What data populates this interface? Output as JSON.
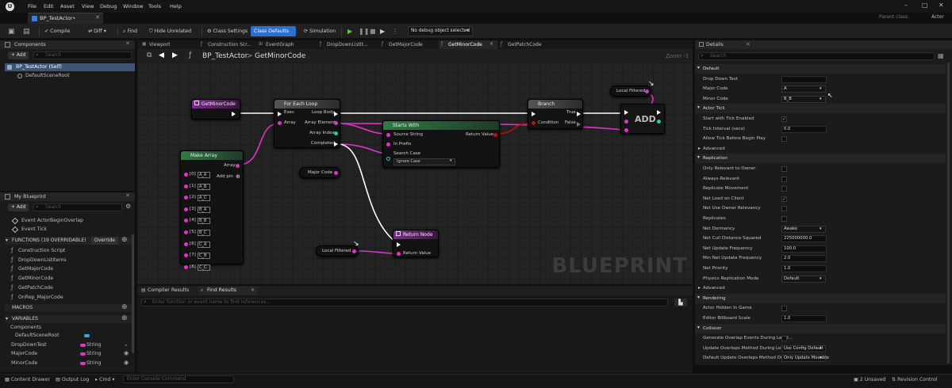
{
  "titlebar": {
    "menus": [
      "File",
      "Edit",
      "Asset",
      "View",
      "Debug",
      "Window",
      "Tools",
      "Help"
    ],
    "parent_label": "Parent class:",
    "parent_value": "Actor"
  },
  "tab": {
    "label": "BP_TestActor•"
  },
  "toolbar": {
    "compile": "Compile",
    "diff": "Diff",
    "find": "Find",
    "hide_unrelated": "Hide Unrelated",
    "class_settings": "Class Settings",
    "class_defaults": "Class Defaults",
    "simulation": "Simulation",
    "debug_object": "No debug object selected"
  },
  "components": {
    "title": "Components",
    "add": "+ Add",
    "search_placeholder": "Search",
    "root": "BP_TestActor (Self)",
    "child": "DefaultSceneRoot"
  },
  "graph_tabs": [
    "Viewport",
    "Construction Scr...",
    "EventGraph",
    "DropDownListIt...",
    "GetMajorCode",
    "GetMinorCode",
    "GetPatchCode"
  ],
  "breadcrumb": {
    "blueprint": "BP_TestActor",
    "sep": ">",
    "function": "GetMinorCode",
    "zoom": "Zoom -1"
  },
  "nodes": {
    "entry": "GetMinorCode",
    "foreach": {
      "title": "For Each Loop",
      "exec": "Exec",
      "array": "Array",
      "loop_body": "Loop Body",
      "array_element": "Array Element",
      "array_index": "Array Index",
      "completed": "Completed"
    },
    "branch": {
      "title": "Branch",
      "condition": "Condition",
      "true": "True",
      "false": "False"
    },
    "add": {
      "title": "ADD",
      "target": "Local Filtered"
    },
    "starts": {
      "title": "Starts With",
      "source": "Source String",
      "prefix": "In Prefix",
      "search_case": "Search Case",
      "case_value": "Ignore Case",
      "return": "Return Value"
    },
    "make_array": {
      "title": "Make Array",
      "array": "Array",
      "add_pin": "Add pin",
      "items": [
        {
          "idx": "[0]",
          "val": "A_A"
        },
        {
          "idx": "[1]",
          "val": "A_B"
        },
        {
          "idx": "[2]",
          "val": "A_C"
        },
        {
          "idx": "[3]",
          "val": "B_A"
        },
        {
          "idx": "[4]",
          "val": "B_B"
        },
        {
          "idx": "[5]",
          "val": "B_C"
        },
        {
          "idx": "[6]",
          "val": "C_A"
        },
        {
          "idx": "[7]",
          "val": "C_B"
        },
        {
          "idx": "[8]",
          "val": "C_C"
        }
      ]
    },
    "major_code": "Major Code",
    "return": {
      "title": "Return Node",
      "value": "Return Value"
    },
    "local_filtered": "Local Filtered"
  },
  "watermark": "BLUEPRINT",
  "my_blueprint": {
    "title": "My Blueprint",
    "add": "+ Add",
    "search_placeholder": "Search",
    "events": [
      "Event ActorBeginOverlap",
      "Event Tick"
    ],
    "functions_header": "FUNCTIONS (19 OVERRIDABLE)",
    "override": "Override",
    "functions": [
      "Construction Script",
      "DropDownListItems",
      "GetMajorCode",
      "GetMinorCode",
      "GetPatchCode",
      "OnRep_MajorCode"
    ],
    "macros": "MACROS",
    "variables": "VARIABLES",
    "components_cat": "Components",
    "variables_list": [
      {
        "name": "DefaultSceneRoot",
        "type": ""
      },
      {
        "name": "DropDownTest",
        "type": "String"
      },
      {
        "name": "MajorCode",
        "type": "String"
      },
      {
        "name": "MinorCode",
        "type": "String"
      }
    ]
  },
  "bottom_tabs": {
    "compiler": "Compiler Results",
    "find": "Find Results",
    "placeholder": "Enter function or event name to find references..."
  },
  "details": {
    "title": "Details",
    "search_placeholder": "Search",
    "rows": [
      {
        "kind": "section",
        "label": "Default"
      },
      {
        "kind": "text",
        "label": "Drop Down Test",
        "value": ""
      },
      {
        "kind": "dropdown",
        "label": "Major Code",
        "value": "A"
      },
      {
        "kind": "dropdown",
        "label": "Minor Code",
        "value": "B_B"
      },
      {
        "kind": "section",
        "label": "Actor Tick"
      },
      {
        "kind": "check",
        "label": "Start with Tick Enabled",
        "value": "✓"
      },
      {
        "kind": "text",
        "label": "Tick Interval (secs)",
        "value": "0.0"
      },
      {
        "kind": "check",
        "label": "Allow Tick Before Begin Play",
        "value": ""
      },
      {
        "kind": "sub",
        "label": "Advanced"
      },
      {
        "kind": "section",
        "label": "Replication"
      },
      {
        "kind": "check",
        "label": "Only Relevant to Owner",
        "value": ""
      },
      {
        "kind": "check",
        "label": "Always Relevant",
        "value": ""
      },
      {
        "kind": "check",
        "label": "Replicate Movement",
        "value": ""
      },
      {
        "kind": "check",
        "label": "Net Load on Client",
        "value": "✓"
      },
      {
        "kind": "check",
        "label": "Net Use Owner Relevancy",
        "value": ""
      },
      {
        "kind": "check",
        "label": "Replicates",
        "value": ""
      },
      {
        "kind": "dropdown",
        "label": "Net Dormancy",
        "value": "Awake"
      },
      {
        "kind": "text",
        "label": "Net Cull Distance Squared",
        "value": "225000000.0"
      },
      {
        "kind": "text",
        "label": "Net Update Frequency",
        "value": "100.0"
      },
      {
        "kind": "text",
        "label": "Min Net Update Frequency",
        "value": "2.0"
      },
      {
        "kind": "text",
        "label": "Net Priority",
        "value": "1.0"
      },
      {
        "kind": "dropdown",
        "label": "Physics Replication Mode",
        "value": "Default"
      },
      {
        "kind": "sub",
        "label": "Advanced"
      },
      {
        "kind": "section",
        "label": "Rendering"
      },
      {
        "kind": "check",
        "label": "Actor Hidden In Game",
        "value": ""
      },
      {
        "kind": "text",
        "label": "Editor Billboard Scale",
        "value": "1.0"
      },
      {
        "kind": "section",
        "label": "Collision"
      },
      {
        "kind": "check",
        "label": "Generate Overlap Events During Level...",
        "value": ""
      },
      {
        "kind": "dropdown",
        "label": "Update Overlaps Method During Level...",
        "value": "Use Config Default"
      },
      {
        "kind": "dropdown",
        "label": "Default Update Overlaps Method Duri...",
        "value": "Only Update Movable"
      }
    ]
  },
  "statusbar": {
    "content_drawer": "Content Drawer",
    "output_log": "Output Log",
    "cmd": "Cmd",
    "console_placeholder": "Enter Console Command",
    "unsaved": "2 Unsaved",
    "revision": "Revision Control"
  }
}
